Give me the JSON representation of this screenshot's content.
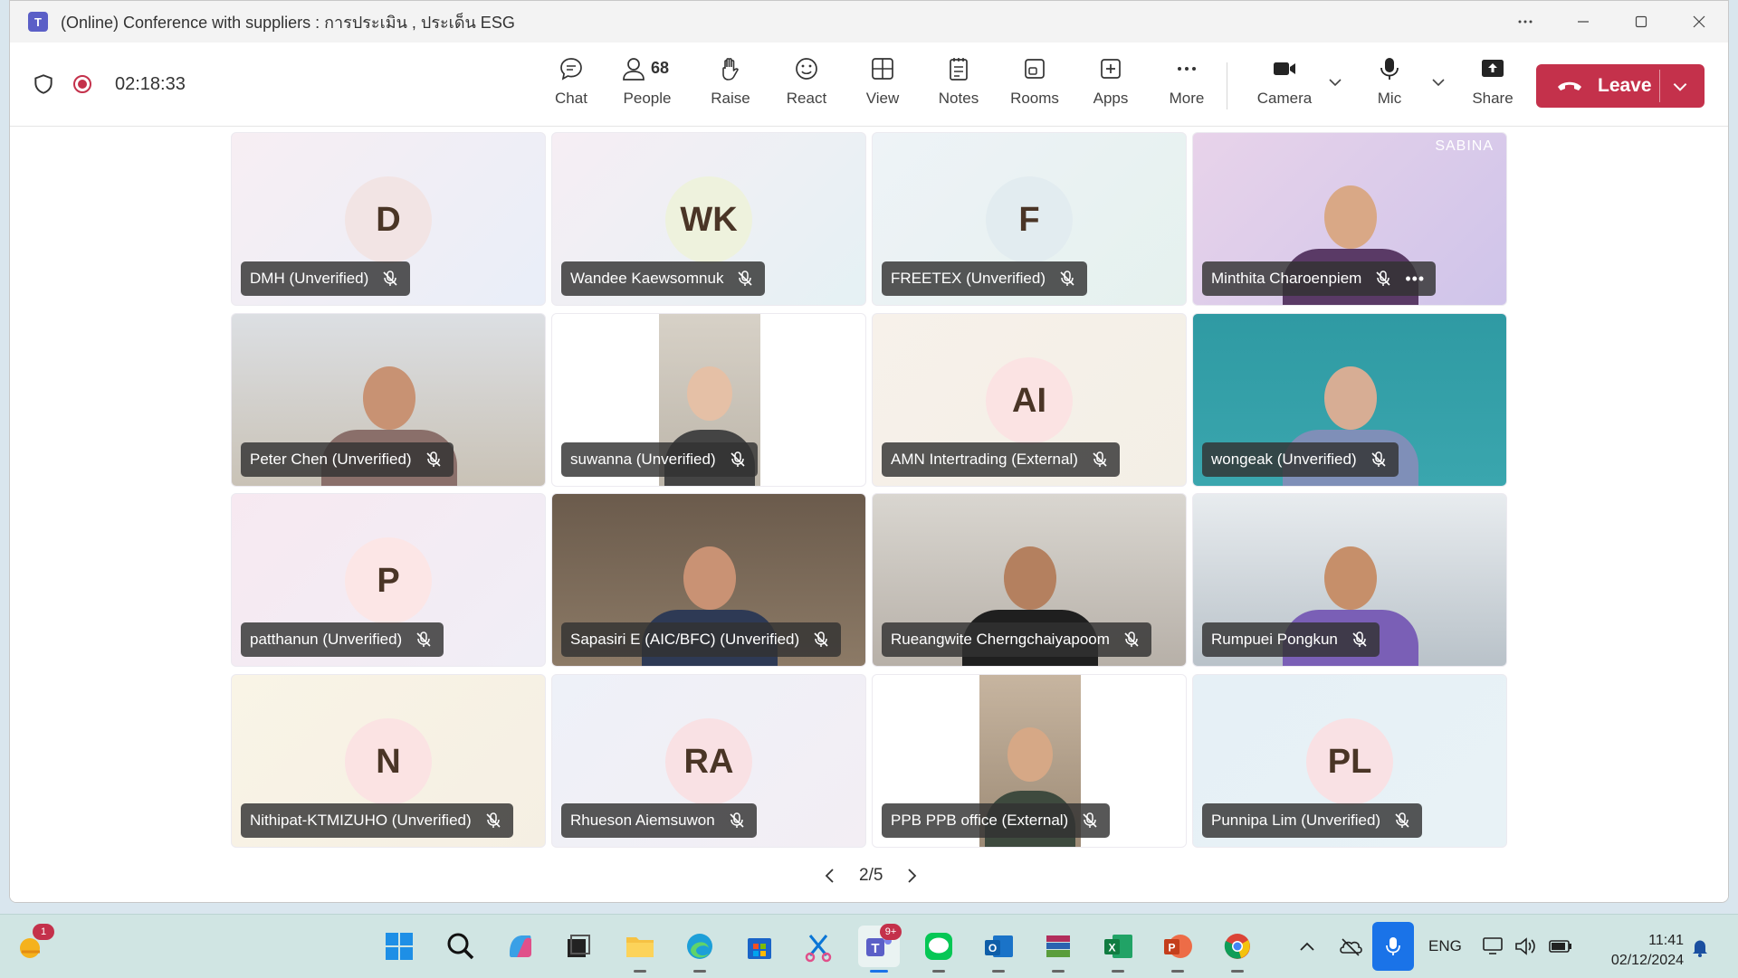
{
  "window": {
    "title_prefix": "(Online) Conference with suppliers : ",
    "title_thai": "การประเมิน , ประเด็น ESG"
  },
  "toolbar": {
    "timer": "02:18:33",
    "buttons": {
      "chat": "Chat",
      "people": "People",
      "people_count": "68",
      "raise": "Raise",
      "react": "React",
      "view": "View",
      "notes": "Notes",
      "rooms": "Rooms",
      "apps": "Apps",
      "more": "More",
      "camera": "Camera",
      "mic": "Mic",
      "share": "Share",
      "leave": "Leave"
    }
  },
  "participants": [
    {
      "name": "DMH (Unverified)",
      "initials": "D",
      "type": "avatar",
      "bg": "#f2e4e4"
    },
    {
      "name": "Wandee Kaewsomnuk",
      "initials": "WK",
      "type": "avatar",
      "bg": "#eef2dd"
    },
    {
      "name": "FREETEX (Unverified)",
      "initials": "F",
      "type": "avatar",
      "bg": "#e2ecf0"
    },
    {
      "name": "Minthita Charoenpiem",
      "initials": "",
      "type": "video",
      "overlay_text": "SABINA"
    },
    {
      "name": "Peter Chen (Unverified)",
      "initials": "",
      "type": "video"
    },
    {
      "name": "suwanna (Unverified)",
      "initials": "",
      "type": "video"
    },
    {
      "name": "AMN Intertrading (External)",
      "initials": "AI",
      "type": "avatar",
      "bg": "#fbe3e3"
    },
    {
      "name": "wongeak (Unverified)",
      "initials": "",
      "type": "video"
    },
    {
      "name": "patthanun (Unverified)",
      "initials": "P",
      "type": "avatar",
      "bg": "#fce6e6"
    },
    {
      "name": "Sapasiri E (AIC/BFC) (Unverified)",
      "initials": "",
      "type": "video"
    },
    {
      "name": "Rueangwite Cherngchaiyapoom",
      "initials": "",
      "type": "video"
    },
    {
      "name": "Rumpuei Pongkun",
      "initials": "",
      "type": "video"
    },
    {
      "name": "Nithipat-KTMIZUHO (Unverified)",
      "initials": "N",
      "type": "avatar",
      "bg": "#fbe3e3"
    },
    {
      "name": "Rhueson Aiemsuwon",
      "initials": "RA",
      "type": "avatar",
      "bg": "#f9e1e4"
    },
    {
      "name": "PPB PPB office (External)",
      "initials": "",
      "type": "video"
    },
    {
      "name": "Punnipa Lim (Unverified)",
      "initials": "PL",
      "type": "avatar",
      "bg": "#f9e1e4"
    }
  ],
  "pager": {
    "label": "2/5"
  },
  "taskbar": {
    "widget_badge": "1",
    "teams_badge": "9+",
    "language": "ENG",
    "time": "11:41",
    "date": "02/12/2024"
  }
}
